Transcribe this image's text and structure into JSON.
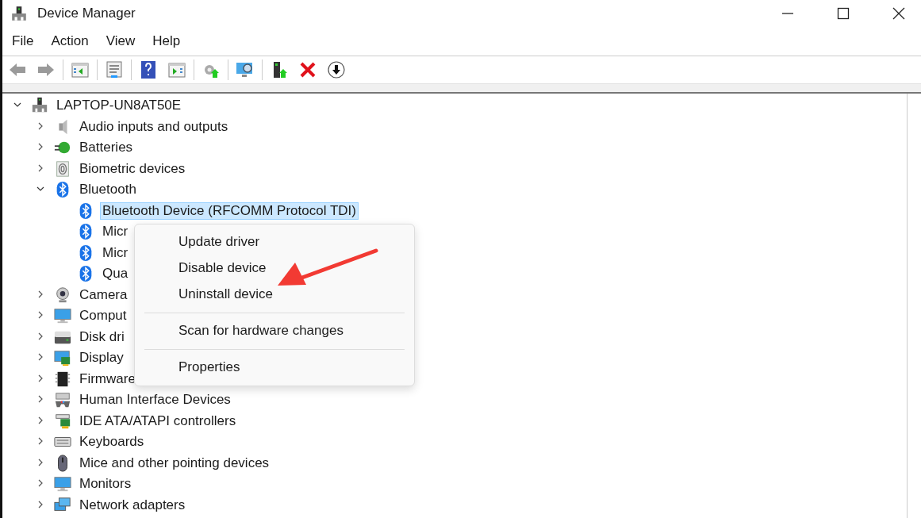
{
  "window": {
    "title": "Device Manager"
  },
  "menu_bar": [
    {
      "label": "File"
    },
    {
      "label": "Action"
    },
    {
      "label": "View"
    },
    {
      "label": "Help"
    }
  ],
  "tree": {
    "label": "LAPTOP-UN8AT50E",
    "kind": "computer",
    "expanded": true,
    "selected": false,
    "children": [
      {
        "label": "Audio inputs and outputs",
        "kind": "speaker",
        "expanded": false,
        "selected": false
      },
      {
        "label": "Batteries",
        "kind": "battery",
        "expanded": false,
        "selected": false
      },
      {
        "label": "Biometric devices",
        "kind": "fingerprint",
        "expanded": false,
        "selected": false
      },
      {
        "label": "Bluetooth",
        "kind": "bluetooth",
        "expanded": true,
        "selected": false,
        "children": [
          {
            "label": "Bluetooth Device (RFCOMM Protocol TDI)",
            "kind": "bluetooth",
            "selected": true
          },
          {
            "label": "Micr",
            "kind": "bluetooth",
            "selected": false
          },
          {
            "label": "Micr",
            "kind": "bluetooth",
            "selected": false
          },
          {
            "label": "Qua",
            "kind": "bluetooth",
            "selected": false
          }
        ]
      },
      {
        "label": "Camera",
        "kind": "webcam",
        "expanded": false,
        "selected": false
      },
      {
        "label": "Comput",
        "kind": "monitor",
        "expanded": false,
        "selected": false
      },
      {
        "label": "Disk dri",
        "kind": "disk",
        "expanded": false,
        "selected": false
      },
      {
        "label": "Display",
        "kind": "display",
        "expanded": false,
        "selected": false
      },
      {
        "label": "Firmware",
        "kind": "chip",
        "expanded": false,
        "selected": false
      },
      {
        "label": "Human Interface Devices",
        "kind": "hid",
        "expanded": false,
        "selected": false
      },
      {
        "label": "IDE ATA/ATAPI controllers",
        "kind": "controller",
        "expanded": false,
        "selected": false
      },
      {
        "label": "Keyboards",
        "kind": "keyboard",
        "expanded": false,
        "selected": false
      },
      {
        "label": "Mice and other pointing devices",
        "kind": "mouse",
        "expanded": false,
        "selected": false
      },
      {
        "label": "Monitors",
        "kind": "monitor",
        "expanded": false,
        "selected": false
      },
      {
        "label": "Network adapters",
        "kind": "network",
        "expanded": false,
        "selected": false
      }
    ]
  },
  "context_menu": [
    {
      "kind": "item",
      "label": "Update driver"
    },
    {
      "kind": "item",
      "label": "Disable device"
    },
    {
      "kind": "item",
      "label": "Uninstall device"
    },
    {
      "kind": "separator"
    },
    {
      "kind": "item",
      "label": "Scan for hardware changes"
    },
    {
      "kind": "separator"
    },
    {
      "kind": "item",
      "label": "Properties"
    }
  ]
}
